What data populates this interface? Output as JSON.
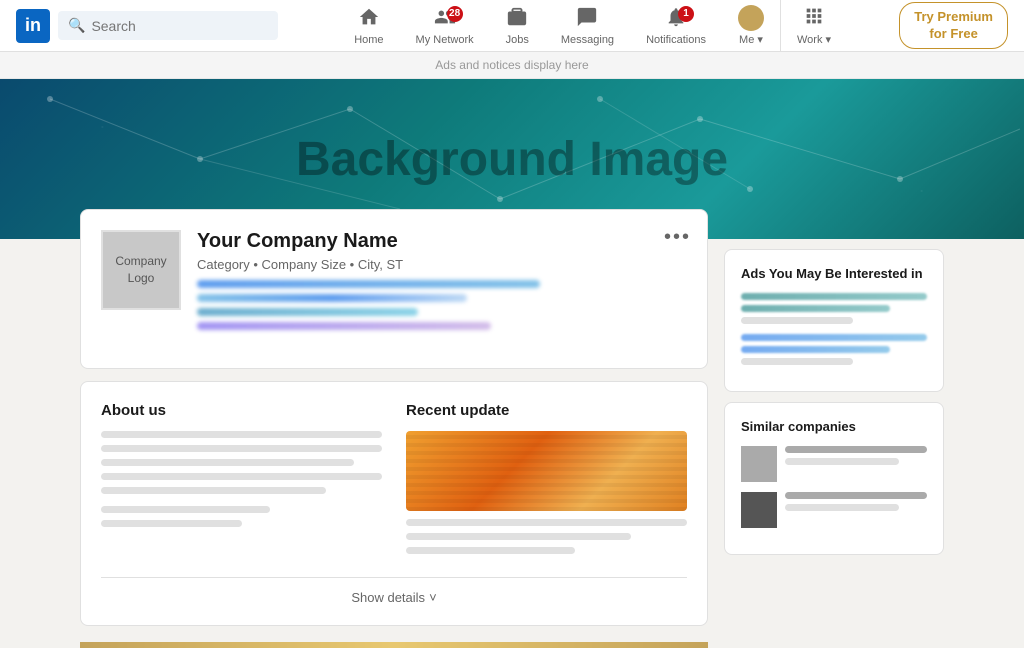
{
  "navbar": {
    "logo_text": "in",
    "search_placeholder": "Search",
    "search_label": "0 Search",
    "nav_items": [
      {
        "id": "home",
        "label": "Home",
        "icon": "⌂",
        "badge": null
      },
      {
        "id": "my-network",
        "label": "My Network",
        "icon": "👥",
        "badge": "28"
      },
      {
        "id": "jobs",
        "label": "Jobs",
        "icon": "💼",
        "badge": null
      },
      {
        "id": "messaging",
        "label": "Messaging",
        "icon": "💬",
        "badge": null
      },
      {
        "id": "notifications",
        "label": "Notifications",
        "icon": "🔔",
        "badge": "1"
      },
      {
        "id": "me",
        "label": "Me ▾",
        "icon": "avatar",
        "badge": null
      },
      {
        "id": "work",
        "label": "Work ▾",
        "icon": "⋮⋮⋮",
        "badge": null
      }
    ],
    "premium_label": "Try Premium\nfor Free"
  },
  "ads_banner": {
    "text": "Ads and notices display here"
  },
  "background": {
    "text": "Background Image"
  },
  "company_card": {
    "more_btn_label": "•••",
    "logo_text": "Company\nLogo",
    "name": "Your Company Name",
    "meta": "Category • Company Size • City, ST"
  },
  "about_section": {
    "about_title": "About us",
    "update_title": "Recent update",
    "show_details": "Show details",
    "chevron": "˅"
  },
  "sidebar": {
    "ads_title": "Ads You May Be Interested in",
    "similar_title": "Similar companies"
  }
}
